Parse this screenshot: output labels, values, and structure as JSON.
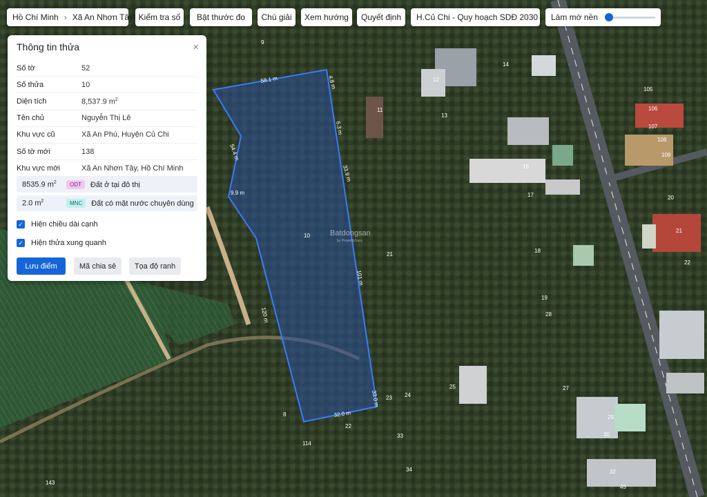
{
  "breadcrumb": {
    "city": "Hồ Chí Minh",
    "ward": "Xã An Nhơn Tây"
  },
  "toolbar": {
    "check_label": "Kiểm tra số",
    "measure_label": "Bật thước đo",
    "legend_label": "Chú giải",
    "direction_label": "Xem hướng",
    "decision_label": "Quyết định",
    "plan_select": "H.Củ Chi - Quy hoạch SDĐ 2030",
    "blur_label": "Làm mờ nền",
    "blur_value": 0
  },
  "panel": {
    "title": "Thông tin thửa",
    "rows": [
      {
        "key": "Số tờ",
        "value": "52"
      },
      {
        "key": "Số thửa",
        "value": "10"
      },
      {
        "key": "Diện tích",
        "value": "8,537.9 m",
        "sup": "2"
      },
      {
        "key": "Tên chủ",
        "value": "Nguyễn Thị Lê"
      },
      {
        "key": "Khu vực cũ",
        "value": "Xã An Phú, Huyện Củ Chi"
      },
      {
        "key": "Số tờ mới",
        "value": "138"
      },
      {
        "key": "Khu vực mới",
        "value": "Xã An Nhơn Tây, Hồ Chí Minh"
      }
    ],
    "areas": [
      {
        "amount": "8535.9 m",
        "sup": "2",
        "code": "ODT",
        "desc": "Đất ở tại đô thị"
      },
      {
        "amount": "2.0 m",
        "sup": "2",
        "code": "MNC",
        "desc": "Đất có mặt nước chuyên dùng"
      }
    ],
    "show_edge_lengths": "Hiện chiều dài cạnh",
    "show_neighbors": "Hiện thửa xung quanh",
    "save_label": "Lưu điểm",
    "share_label": "Mã chia sẻ",
    "coords_label": "Tọa độ ranh"
  },
  "map": {
    "parcel_number": "10",
    "edge_labels": [
      "58.1 m",
      "4.8 m",
      "54.4 m",
      "9.9 m",
      "33.9 m",
      "6.3 m",
      "120 m",
      "101 m",
      "32.0 m",
      "33.0 m"
    ],
    "parcel_numbers": [
      "9",
      "11",
      "12",
      "13",
      "14",
      "16",
      "105",
      "108",
      "106",
      "107",
      "109",
      "20",
      "21",
      "21",
      "22",
      "17",
      "18",
      "19",
      "28",
      "23",
      "24",
      "25",
      "27",
      "29",
      "30",
      "32",
      "22",
      "33",
      "34",
      "114",
      "143",
      "8",
      "45"
    ],
    "watermark": "Batdongsan",
    "watermark_sub": "by PropertyGuru"
  },
  "colors": {
    "accent": "#1565d8",
    "parcel_stroke": "#3a7bff",
    "parcel_fill": "#2a4f9a"
  }
}
